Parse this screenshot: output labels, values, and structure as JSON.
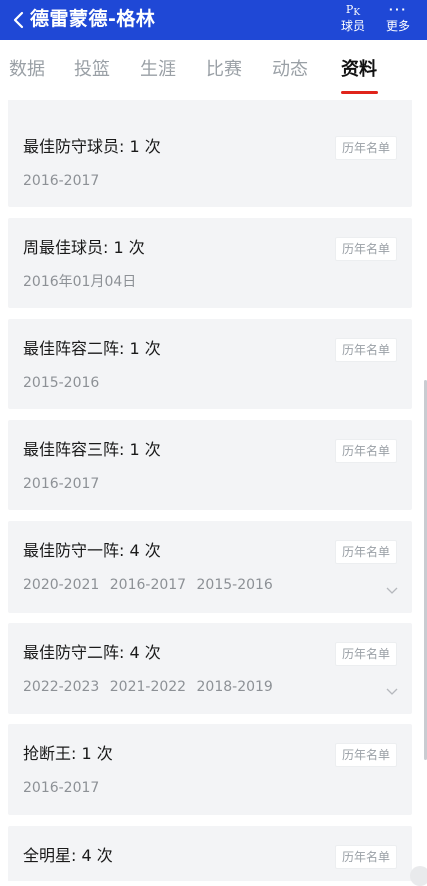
{
  "header": {
    "title": "德雷蒙德-格林",
    "pk_glyph": "P",
    "pk_glyph_sub": "K",
    "pk_label": "球员",
    "more_glyph": "···",
    "more_label": "更多"
  },
  "tabs": [
    {
      "label": "数据"
    },
    {
      "label": "投篮"
    },
    {
      "label": "生涯"
    },
    {
      "label": "比赛"
    },
    {
      "label": "动态"
    },
    {
      "label": "资料",
      "active": true
    }
  ],
  "honors": [
    {
      "title": "最佳防守球员: 1 次",
      "years": "2016-2017",
      "button": "历年名单"
    },
    {
      "title": "周最佳球员: 1 次",
      "years": "2016年01月04日",
      "button": "历年名单"
    },
    {
      "title": "最佳阵容二阵: 1 次",
      "years": "2015-2016",
      "button": "历年名单"
    },
    {
      "title": "最佳阵容三阵: 1 次",
      "years": "2016-2017",
      "button": "历年名单"
    },
    {
      "title": "最佳防守一阵: 4 次",
      "years": "2020-2021 2016-2017 2015-2016",
      "button": "历年名单",
      "expandable": true
    },
    {
      "title": "最佳防守二阵: 4 次",
      "years": "2022-2023 2021-2022 2018-2019",
      "button": "历年名单",
      "expandable": true
    },
    {
      "title": "抢断王: 1 次",
      "years": "2016-2017",
      "button": "历年名单"
    },
    {
      "title": "全明星: 4 次",
      "years": "",
      "button": "历年名单"
    }
  ],
  "colors": {
    "header_bg": "#1f48d6",
    "active_tab_underline": "#e0241b"
  }
}
